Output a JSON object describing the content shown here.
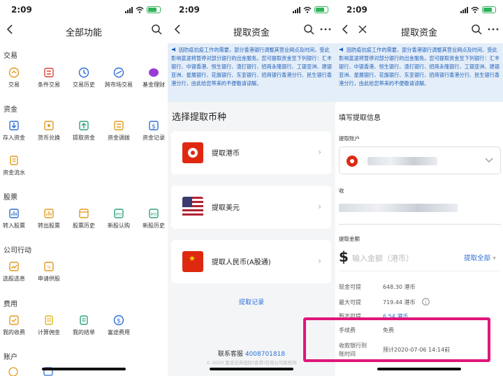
{
  "status": {
    "time": "2:09"
  },
  "p1": {
    "title": "全部功能",
    "sections": [
      {
        "title": "交易",
        "items": [
          "交易",
          "条件交易",
          "交易历史",
          "跨市场交易",
          "基金理财"
        ]
      },
      {
        "title": "资金",
        "items": [
          "存入资金",
          "货币兑换",
          "提取资金",
          "资金调拨",
          "资金记录",
          "资金流水"
        ]
      },
      {
        "title": "股票",
        "items": [
          "转入股票",
          "转出股票",
          "股票历史",
          "新股认购",
          "新股历史"
        ]
      },
      {
        "title": "公司行动",
        "items": [
          "选股选息",
          "申请供股"
        ]
      },
      {
        "title": "费用",
        "items": [
          "我的收费",
          "计算佣金",
          "我的结单",
          "富途费用"
        ]
      },
      {
        "title": "账户",
        "items": []
      }
    ]
  },
  "p2": {
    "title": "提取资金",
    "notice": "因防疫抗疫工作的需要，部分香港银行调整其营业网点及时间，受此影响富途将暂停对部分银行的出金服务。您可提取资金至下列银行：汇丰银行、中银香港、恒生银行、渣打银行、招商永隆银行、工银亚洲、建银亚洲、星展银行、花旗银行、东亚银行、招商银行香港分行、民生银行香港分行，由此给您带来的不便敬请谅解。",
    "select_title": "选择提取币种",
    "options": [
      "提取港币",
      "提取美元",
      "提取人民币(A股通)"
    ],
    "record_link": "提取记录",
    "service_label": "联系客服",
    "service_phone": "4008701818",
    "copyright": "© 2020 富途证券国际(香港)有限公司版权所"
  },
  "p3": {
    "title": "提取资金",
    "notice": "因防疫抗疫工作的需要，部分香港银行调整其营业网点及时间，受此影响富途将暂停对部分银行的出金服务。您可提取资金至下列银行：汇丰银行、中银香港、恒生银行、渣打银行、招商永隆银行、工银亚洲、建银亚洲、星展银行、花旗银行、东亚银行、招商银行香港分行、民生银行香港分行，由此给您带来的不便敬请谅解。",
    "fill_title": "填写提取信息",
    "account_label": "提取账户",
    "receive_label": "收",
    "amount_label": "提取金额",
    "currency_symbol": "$",
    "amount_placeholder": "输入金额（港币）",
    "withdraw_all": "提取全部",
    "rows": [
      {
        "label": "现金可提",
        "value": "648.30 港币"
      },
      {
        "label": "最大可提",
        "value": "719.44 港币"
      },
      {
        "label": "暂不可提",
        "value": "6.54 港币"
      },
      {
        "label": "手续费",
        "value": "免费"
      },
      {
        "label": "收款银行到账时间",
        "value": "预计2020-07-06 14:14前"
      }
    ],
    "highlight_color": "#e0167b"
  }
}
